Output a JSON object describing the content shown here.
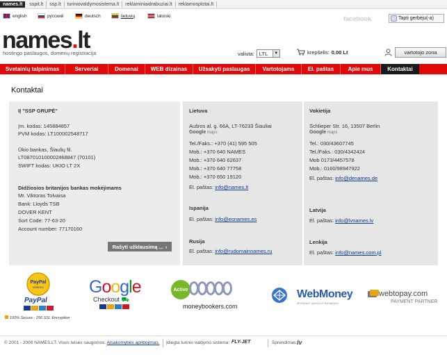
{
  "site_tabs": [
    "names.lt",
    "sspit.lt",
    "ssp.lt",
    "turiniovaldymosistema.lt",
    "reklaminiaidrabuziai.lt",
    "reklamosplotai.lt"
  ],
  "languages": [
    {
      "label": "english",
      "flag": "gb-flag-icon"
    },
    {
      "label": "русский",
      "flag": "ru-flag-icon"
    },
    {
      "label": "deutsch",
      "flag": "de-flag-icon"
    },
    {
      "label": "lietuvių",
      "flag": "lt-flag-icon"
    },
    {
      "label": "latviski",
      "flag": "lv-flag-icon"
    }
  ],
  "social": {
    "facebook": "facebook",
    "like_label": "Tapti gerbėju(-a)"
  },
  "header": {
    "logo_main": "names",
    "logo_dot": ".",
    "logo_tld": "lt",
    "tagline": "hostingo paslaugos, domenų registracija",
    "currency_label": "valiuta:",
    "currency_value": "LTL",
    "cart_label": "krepšelis:",
    "cart_value": "0.00 Lt",
    "user_button": "vartotojo zona"
  },
  "nav": [
    "Svetainių talpinimas",
    "Serveriai",
    "Domenai",
    "WEB dizainas",
    "Užsakyti paslaugas",
    "Vartotojams",
    "El. paštas",
    "Apie mus",
    "Kontaktai"
  ],
  "page_title": "Kontaktai",
  "company": {
    "name": "IĮ \"SSP GRUPĖ\"",
    "code": "Įm. kodas: 145884857",
    "vat": "PVM kodas: LT100002548717",
    "bank": "Ūkio bankas, Šiaulių fil.",
    "account": "LT087010100002468847 (70101)",
    "swift": "SWIFT kodas: UKIO LT 2X",
    "uk_heading": "Didžiosios britanijos bankas mokėjimams",
    "uk_lines": [
      "Mr. Viktoras Tolvaisa",
      "Bank: Lloyds TSB",
      "DOVER KENT",
      "Sort Code: 77-63-20",
      "Account number: 77170160"
    ],
    "write_button": "Rašyti užklausimą ..."
  },
  "lithuania": {
    "heading": "Lietuva",
    "address": "Aušros al. g. 66A, LT-76233 Šiauliai",
    "maps": "maps",
    "phones": [
      "Tel./Faks.: +370 (41) 595 505",
      "Mob.: +370 640 NAMES",
      "Mob.: +370 640 62637",
      "Mob.: +370 640 77758",
      "Mob.: +370 650 19120"
    ],
    "email_label": "El. paštas:",
    "email": "info@names.lt"
  },
  "germany": {
    "heading": "Vokietija",
    "address": "Schlieper Str. 16, 13507 Berlin",
    "maps": "maps",
    "phones": [
      "Tel.: 030/43607745",
      "Tel./Faks.: 030/4342424",
      "Mob 0173/4457578",
      "Mob.: 0160/98947922"
    ],
    "email_label": "El. paštas:",
    "email": "info@denames.de"
  },
  "spain": {
    "heading": "Ispanija",
    "email_label": "El. paštas:",
    "email": "info@esnames.es"
  },
  "latvia": {
    "heading": "Latvija",
    "email_label": "El. paštas:",
    "email": "info@lvnames.lv"
  },
  "russia": {
    "heading": "Rusija",
    "email_label": "El. paštas:",
    "email": "info@rudomainnames.ru"
  },
  "poland": {
    "heading": "Lenkija",
    "email_label": "El. paštas:",
    "email": "info@names.com.pl"
  },
  "payments": {
    "paypal_badge": "PayPal",
    "paypal_badge_sub": "VERIFIED",
    "paypal": "PayPal",
    "secure": "100% Secure - 256 SSL Encryption",
    "google_letters": [
      "G",
      "o",
      "o",
      "g",
      "l",
      "e"
    ],
    "google_checkout": "Checkout",
    "mb_active": "Active",
    "moneybookers": "moneybookers.com",
    "webmoney": "WebMoney",
    "webmoney_sub": "Интернет деньги в Беларуси",
    "webtopay": "webtopay.com",
    "webtopay_sub": "PAYMENT PARTNER"
  },
  "footer": {
    "copyright": "© 2001 - 2009 NAMES.LT. Visos teisės saugomos.",
    "rules": "Atsakomybės apribojimas.",
    "cms_label": "Įdiegta turinio valdymo sistema:",
    "cms": "FLY-JET",
    "solutions_label": "Sprendimas:",
    "solutions_logo": "lv"
  },
  "colors": {
    "brand_red": "#e10a0a",
    "nav_active": "#1a1a1a",
    "link": "#0b3a8c"
  }
}
